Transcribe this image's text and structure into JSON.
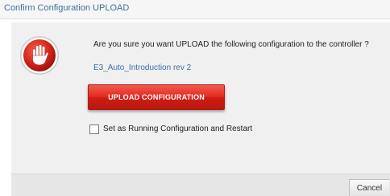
{
  "dialog": {
    "title": "Confirm Configuration UPLOAD",
    "question": "Are you sure you want UPLOAD the following configuration to the controller ?",
    "configuration_name": "E3_Auto_Introduction rev 2",
    "upload_button_label": "UPLOAD CONFIGURATION",
    "checkbox_label": "Set as Running Configuration and Restart",
    "checkbox_checked": false,
    "cancel_button_label": "Cancel",
    "icon": "stop-hand-icon",
    "colors": {
      "title_text": "#3f6fa3",
      "config_name_text": "#3a6fa8",
      "upload_button": "#e42b20",
      "stop_icon_red": "#d8281c"
    }
  }
}
